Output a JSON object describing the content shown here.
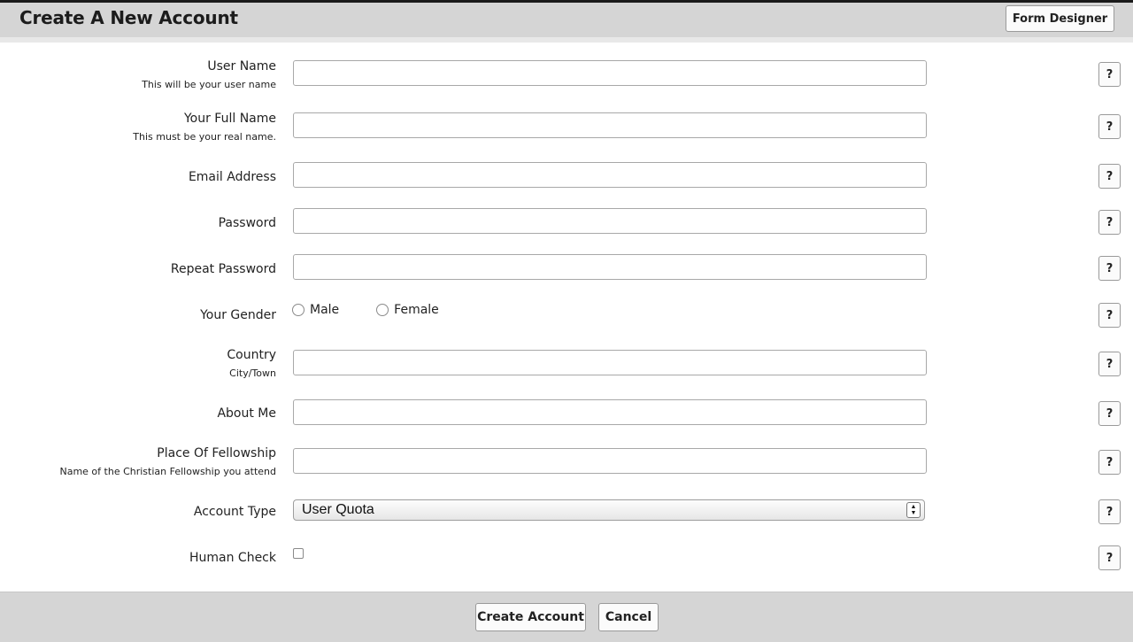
{
  "header": {
    "title": "Create A New Account",
    "form_designer_label": "Form Designer"
  },
  "fields": {
    "user_name": {
      "label": "User Name",
      "sub": "This will be your user name",
      "value": ""
    },
    "full_name": {
      "label": "Your Full Name",
      "sub": "This must be your real name.",
      "value": ""
    },
    "email": {
      "label": "Email Address",
      "value": ""
    },
    "password": {
      "label": "Password",
      "value": ""
    },
    "repeat_password": {
      "label": "Repeat Password",
      "value": ""
    },
    "gender": {
      "label": "Your Gender",
      "options": [
        "Male",
        "Female"
      ],
      "selected": ""
    },
    "country": {
      "label": "Country",
      "sub": "City/Town",
      "value": ""
    },
    "about_me": {
      "label": "About Me",
      "value": ""
    },
    "fellowship": {
      "label": "Place Of Fellowship",
      "sub": "Name of the Christian Fellowship you attend",
      "value": ""
    },
    "account_type": {
      "label": "Account Type",
      "selected": "User Quota"
    },
    "human_check": {
      "label": "Human Check",
      "checked": false
    }
  },
  "help_label": "?",
  "footer": {
    "create_label": "Create Account",
    "cancel_label": "Cancel"
  },
  "colors": {
    "header_bg": "#d5d5d5",
    "top_line": "#1a1a1a",
    "input_border": "#a8a8a8"
  },
  "icons": {
    "help": "question-mark-icon",
    "select_arrow": "up-down-chevron-icon"
  }
}
